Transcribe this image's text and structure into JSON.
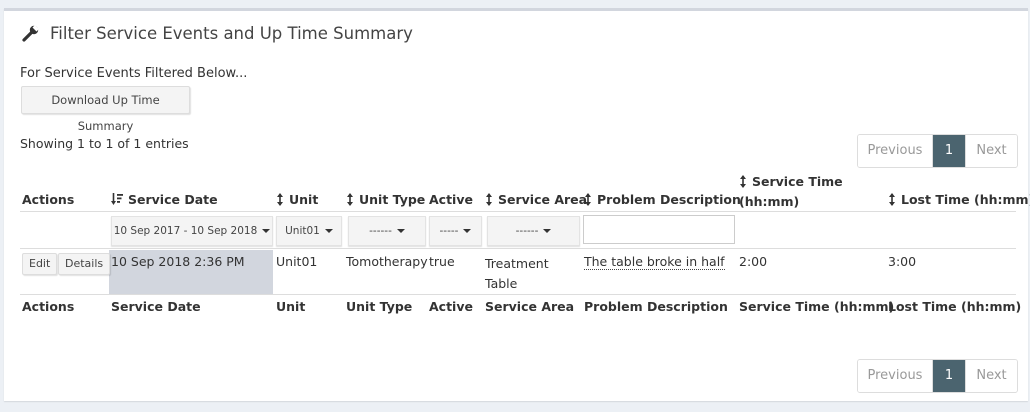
{
  "header": {
    "title": "Filter Service Events and Up Time Summary",
    "icon": "wrench-icon"
  },
  "intro_text": "For Service Events Filtered Below...",
  "download_button": "Download Up Time Summary",
  "showing": "Showing 1 to 1 of 1 entries",
  "pagination": {
    "previous": "Previous",
    "current": "1",
    "next": "Next"
  },
  "columns": {
    "actions": "Actions",
    "service_date": "Service Date",
    "unit": "Unit",
    "unit_type": "Unit Type",
    "active": "Active",
    "service_area": "Service Area",
    "problem_description": "Problem Description",
    "service_time": "Service Time (hh:mm)",
    "service_time_line1": "Service Time",
    "service_time_line2": "(hh:mm)",
    "lost_time": "Lost Time (hh:mm)"
  },
  "filters": {
    "service_date": "10 Sep 2017 - 10 Sep 2018",
    "unit": "Unit01",
    "unit_type": "------",
    "active": "-----",
    "service_area": "------",
    "problem_description": ""
  },
  "rows": [
    {
      "edit": "Edit",
      "details": "Details",
      "service_date": "10 Sep 2018 2:36 PM",
      "unit": "Unit01",
      "unit_type": "Tomotherapy",
      "active": "true",
      "service_area_line1": "Treatment",
      "service_area_line2": "Table",
      "problem_description": "The table broke in half",
      "service_time": "2:00",
      "lost_time": "3:00"
    }
  ],
  "colors": {
    "pager_active": "#4b646f",
    "highlight": "#d2d6de",
    "background": "#ecf0f5"
  }
}
